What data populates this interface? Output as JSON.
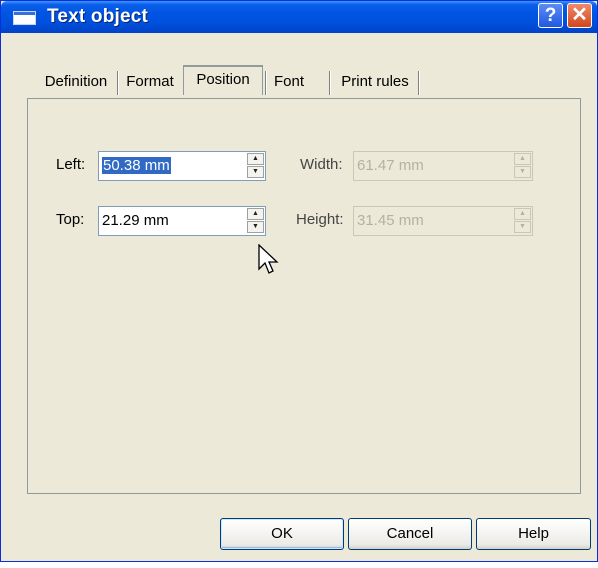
{
  "window": {
    "title": "Text object",
    "help_symbol": "?",
    "close_symbol": "✕"
  },
  "tabs": [
    {
      "label": "Definition",
      "active": false
    },
    {
      "label": "Format",
      "active": false
    },
    {
      "label": "Position",
      "active": true
    },
    {
      "label": "Font",
      "active": false
    },
    {
      "label": "Print rules",
      "active": false
    }
  ],
  "position": {
    "left": {
      "label": "Left:",
      "value": "50.38 mm",
      "selected": true,
      "enabled": true
    },
    "top": {
      "label": "Top:",
      "value": "21.29 mm",
      "enabled": true
    },
    "width": {
      "label": "Width:",
      "value": "61.47 mm",
      "enabled": false
    },
    "height": {
      "label": "Height:",
      "value": "31.45 mm",
      "enabled": false
    }
  },
  "buttons": {
    "ok": "OK",
    "cancel": "Cancel",
    "help": "Help"
  },
  "icons": {
    "spin_up": "▲",
    "spin_down": "▼",
    "app": "window-icon",
    "cursor": "mouse-pointer-icon"
  },
  "colors": {
    "titlebar": "#0054E3",
    "dialog_bg": "#ECE9D8",
    "selection": "#316AC5"
  }
}
